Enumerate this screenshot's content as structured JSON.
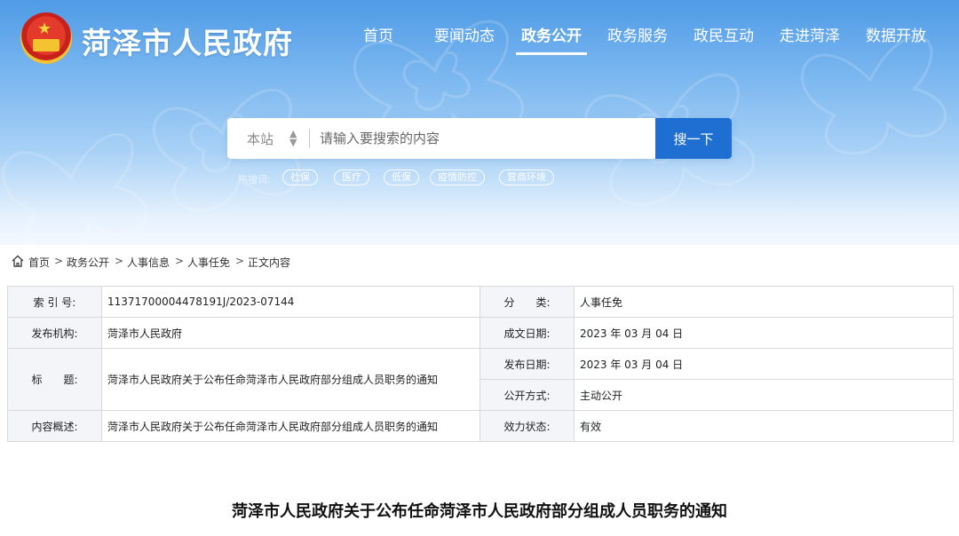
{
  "site": {
    "title": "菏泽市人民政府"
  },
  "nav": {
    "items": [
      "首页",
      "要闻动态",
      "政务公开",
      "政务服务",
      "政民互动",
      "走进菏泽",
      "数据开放"
    ],
    "active": "政务公开"
  },
  "search": {
    "scope": "本站",
    "placeholder": "请输入要搜索的内容",
    "button": "搜一下"
  },
  "hot": {
    "label": "热搜词:",
    "tags": [
      "社保",
      "医疗",
      "低保",
      "疫情防控",
      "营商环境"
    ]
  },
  "breadcrumb": [
    "首页",
    "政务公开",
    "人事信息",
    "人事任免",
    "正文内容"
  ],
  "info": {
    "index_label": "索 引 号:",
    "index_value": "11371700004478191J/2023-07144",
    "category_label": "分　　类:",
    "category_value": "人事任免",
    "publisher_label": "发布机构:",
    "publisher_value": "菏泽市人民政府",
    "created_label": "成文日期:",
    "created_value": "2023 年 03 月 04 日",
    "title_label": "标　　题:",
    "title_value": "菏泽市人民政府关于公布任命菏泽市人民政府部分组成人员职务的通知",
    "pubdate_label": "发布日期:",
    "pubdate_value": "2023 年 03 月 04 日",
    "open_label": "公开方式:",
    "open_value": "主动公开",
    "summary_label": "内容概述:",
    "summary_value": "菏泽市人民政府关于公布任命菏泽市人民政府部分组成人员职务的通知",
    "status_label": "效力状态:",
    "status_value": "有效"
  },
  "article": {
    "title": "菏泽市人民政府关于公布任命菏泽市人民政府部分组成人员职务的通知"
  },
  "colors": {
    "primary": "#1e6fd1",
    "banner_top": "#4f9be6",
    "banner_bottom": "#f4f9ff",
    "label_bg": "#f3f5f8",
    "border": "#d9d9d9"
  }
}
